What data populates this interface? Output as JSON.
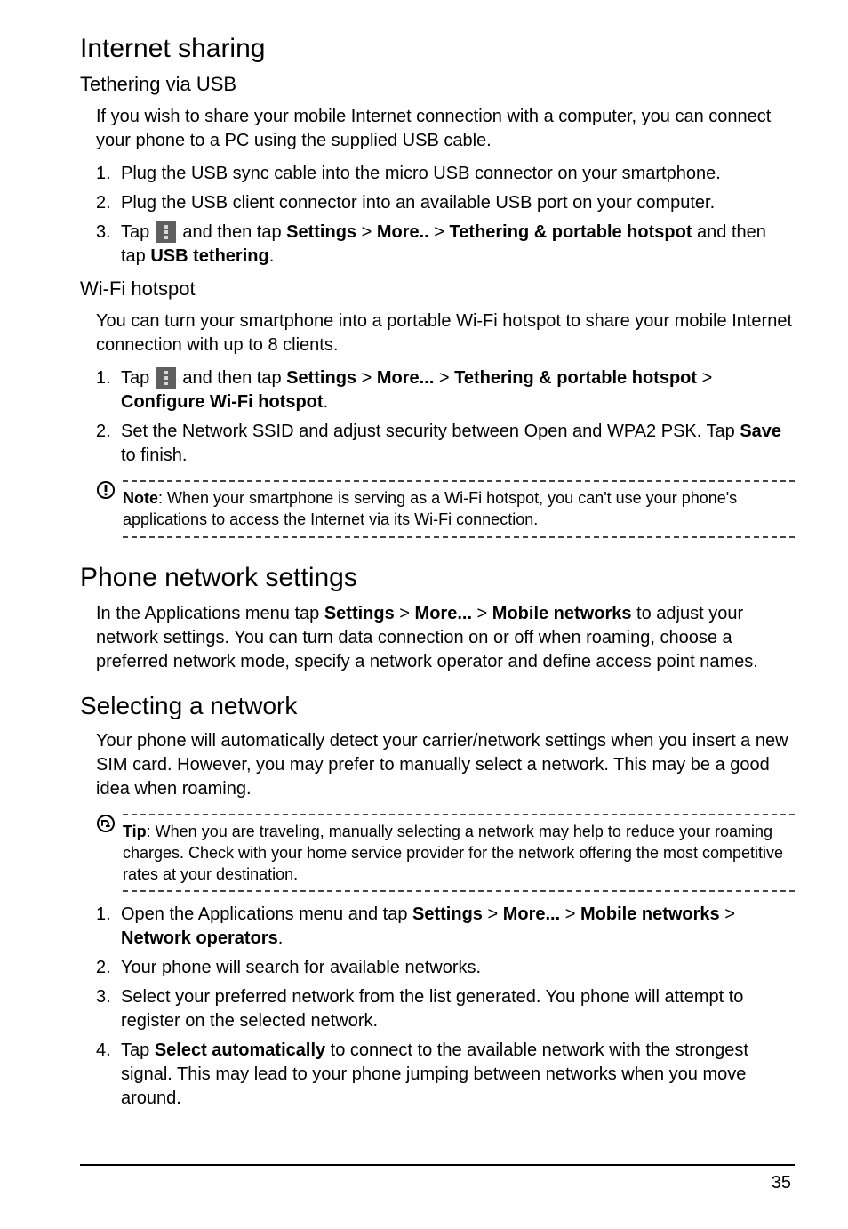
{
  "headings": {
    "internet_sharing": "Internet sharing",
    "tethering_usb": "Tethering via USB",
    "wifi_hotspot": "Wi-Fi hotspot",
    "phone_network": "Phone network settings",
    "selecting_network": "Selecting a network"
  },
  "tethering_usb": {
    "intro": "If you wish to share your mobile Internet connection with a computer, you can connect your phone to a PC using the supplied USB cable.",
    "steps": {
      "s1": "Plug the USB sync cable into the micro USB connector on your smartphone.",
      "s2": "Plug the USB client connector into an available USB port on your computer.",
      "s3_a": "Tap ",
      "s3_b": " and then tap ",
      "s3_settings": "Settings",
      "s3_gt1": " > ",
      "s3_more": "More..",
      "s3_gt2": " > ",
      "s3_tether": "Tethering & portable hotspot",
      "s3_c": " and then tap ",
      "s3_usb": "USB tethering",
      "s3_d": "."
    }
  },
  "wifi_hotspot": {
    "intro": "You can turn your smartphone into a portable Wi-Fi hotspot to share your mobile Internet connection with up to 8 clients.",
    "steps": {
      "s1_a": "Tap ",
      "s1_b": " and then tap ",
      "s1_settings": "Settings",
      "s1_gt1": " > ",
      "s1_more": "More...",
      "s1_gt2": " > ",
      "s1_tether": "Tethering & portable hotspot",
      "s1_gt3": " > ",
      "s1_conf": "Configure Wi-Fi hotspot",
      "s1_d": ".",
      "s2_a": "Set the Network SSID and adjust security between Open and WPA2 PSK. Tap ",
      "s2_save": "Save",
      "s2_b": " to finish."
    },
    "note_label": "Note",
    "note_text": ": When your smartphone is serving as a Wi-Fi hotspot, you can't use your phone's applications to access the Internet via its Wi-Fi connection."
  },
  "phone_network": {
    "intro_a": "In the Applications menu tap ",
    "intro_settings": "Settings",
    "intro_gt1": " > ",
    "intro_more": "More...",
    "intro_gt2": " > ",
    "intro_mobile": "Mobile networks",
    "intro_b": " to adjust your network settings. You can turn data connection on or off when roaming, choose a preferred network mode, specify a network operator and define access point names."
  },
  "selecting_network": {
    "intro": "Your phone will automatically detect your carrier/network settings when you insert a new SIM card. However, you may prefer to manually select a network. This may be a good idea when roaming.",
    "tip_label": "Tip",
    "tip_text": ": When you are traveling, manually selecting a network may help to reduce your roaming charges. Check with your home service provider for the network offering the most competitive rates at your destination.",
    "steps": {
      "s1_a": "Open the Applications menu and tap ",
      "s1_settings": "Settings",
      "s1_gt1": " > ",
      "s1_more": "More...",
      "s1_gt2": " > ",
      "s1_mobile": "Mobile networks",
      "s1_gt3": " > ",
      "s1_netop": "Network operators",
      "s1_d": ".",
      "s2": "Your phone will search for available networks.",
      "s3": "Select your preferred network from the list generated. You phone will attempt to register on the selected network.",
      "s4_a": "Tap ",
      "s4_sel": "Select automatically",
      "s4_b": " to connect to the available network with the strongest signal. This may lead to your phone jumping between networks when you move around."
    }
  },
  "page_number": "35"
}
